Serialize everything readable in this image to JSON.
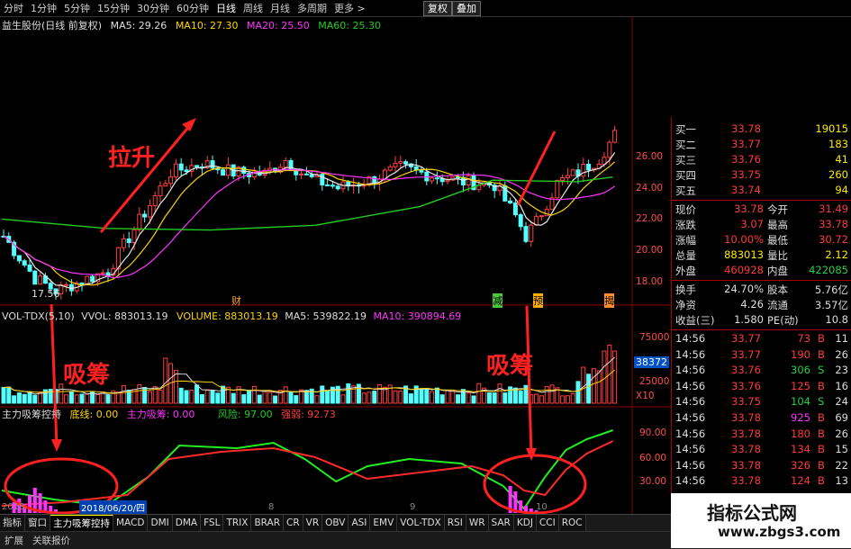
{
  "toolbar": {
    "items": [
      "分时",
      "1分钟",
      "5分钟",
      "15分钟",
      "30分钟",
      "60分钟",
      "日线",
      "周线",
      "月线",
      "多周期",
      "更多 >"
    ],
    "active": "日线",
    "fuquan_label": "复权",
    "diejia_label": "叠加"
  },
  "main_chart": {
    "title": "益生股份(日线 前复权)",
    "ma_labels": [
      "MA5: 29.26",
      "MA10: 27.30",
      "MA20: 25.50",
      "MA60: 25.30"
    ],
    "low_marker": "17.56",
    "event_marks": [
      "财",
      "减",
      "预",
      "揭"
    ],
    "price_ticks": [
      "26.00",
      "24.00",
      "22.00",
      "20.00",
      "18.00"
    ],
    "colors": {
      "ma5": "#e8e8e8",
      "ma10": "#ffd400",
      "ma20": "#ff33ff",
      "ma60": "#22cc22",
      "up": "#ff4040",
      "down": "#54ffff"
    }
  },
  "volume_chart": {
    "title_parts": [
      "VOL-TDX(5,10)",
      "VVOL: 883013.19",
      "VOLUME: 883013.19",
      "MA5: 539822.19",
      "MA10: 390894.69"
    ],
    "axis_ticks": [
      "75000",
      "50000",
      "25000"
    ],
    "current_box": "38372",
    "multiplier": "X10"
  },
  "indicator_chart": {
    "title_parts": [
      "主力吸筹控持",
      "底线: 0.00",
      "主力吸筹: 0.00",
      "风险: 97.00",
      "强弱: 92.73"
    ],
    "axis_ticks": [
      "90.00",
      "60.00",
      "30.00"
    ],
    "date_label": "2018/06/20/四",
    "month_labels": [
      "2018",
      "8",
      "9",
      "10"
    ]
  },
  "annotations": {
    "rise": "拉升",
    "absorb_left": "吸筹",
    "absorb_right": "吸筹"
  },
  "quote_panel": {
    "bids": [
      {
        "label": "买一",
        "price": "33.78",
        "vol": "19015"
      },
      {
        "label": "买二",
        "price": "33.77",
        "vol": "183"
      },
      {
        "label": "买三",
        "price": "33.76",
        "vol": "41"
      },
      {
        "label": "买四",
        "price": "33.75",
        "vol": "260"
      },
      {
        "label": "买五",
        "price": "33.74",
        "vol": "94"
      }
    ],
    "stats": [
      {
        "k1": "现价",
        "v1": "33.78",
        "k2": "今开",
        "v2": "31.49"
      },
      {
        "k1": "涨跌",
        "v1": "3.07",
        "k2": "最高",
        "v2": "33.78"
      },
      {
        "k1": "涨幅",
        "v1": "10.00%",
        "k2": "最低",
        "v2": "30.72"
      },
      {
        "k1": "总量",
        "v1": "883013",
        "k2": "量比",
        "v2": "2.12"
      },
      {
        "k1": "外盘",
        "v1": "460928",
        "k2": "内盘",
        "v2": "422085"
      }
    ],
    "stats2": [
      {
        "k1": "换手",
        "v1": "24.70%",
        "k2": "股本",
        "v2": "5.76亿"
      },
      {
        "k1": "净资",
        "v1": "4.26",
        "k2": "流通",
        "v2": "3.57亿"
      },
      {
        "k1": "收益(三)",
        "v1": "1.580",
        "k2": "PE(动)",
        "v2": "10.8"
      }
    ],
    "ticks": [
      {
        "time": "14:56",
        "price": "33.77",
        "vol": "73",
        "side": "B",
        "n": "11"
      },
      {
        "time": "14:56",
        "price": "33.77",
        "vol": "190",
        "side": "B",
        "n": "26"
      },
      {
        "time": "14:56",
        "price": "33.76",
        "vol": "306",
        "side": "S",
        "n": "23"
      },
      {
        "time": "14:56",
        "price": "33.76",
        "vol": "125",
        "side": "B",
        "n": "16"
      },
      {
        "time": "14:56",
        "price": "33.75",
        "vol": "104",
        "side": "S",
        "n": "24"
      },
      {
        "time": "14:56",
        "price": "33.78",
        "vol": "925",
        "side": "B",
        "n": "69"
      },
      {
        "time": "14:56",
        "price": "33.78",
        "vol": "180",
        "side": "B",
        "n": "26"
      },
      {
        "time": "14:56",
        "price": "33.78",
        "vol": "134",
        "side": "B",
        "n": "15"
      },
      {
        "time": "14:56",
        "price": "33.78",
        "vol": "326",
        "side": "B",
        "n": "22"
      },
      {
        "time": "14:56",
        "price": "33.78",
        "vol": "124",
        "side": "B",
        "n": "13"
      }
    ]
  },
  "tabs": [
    "指标",
    "窗口",
    "主力吸筹控持",
    "MACD",
    "DMI",
    "DMA",
    "FSL",
    "TRIX",
    "BRAR",
    "CR",
    "VR",
    "OBV",
    "ASI",
    "EMV",
    "VOL-TDX",
    "RSI",
    "WR",
    "SAR",
    "KDJ",
    "CCI",
    "ROC"
  ],
  "active_tab": "主力吸筹控持",
  "tabs_right": [
    "模板",
    "日线"
  ],
  "bottom_bar": [
    "扩展",
    "关联报价"
  ],
  "watermark": {
    "line1": "指标公式网",
    "line2": "www.zbgs3.com"
  }
}
